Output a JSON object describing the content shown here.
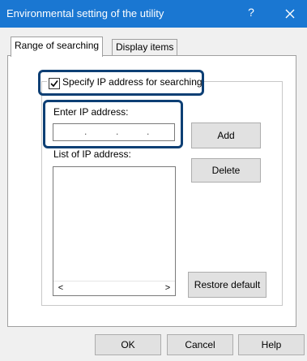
{
  "window": {
    "title": "Environmental setting of the utility",
    "help_label": "?"
  },
  "tabs": [
    {
      "label": "Range of searching"
    },
    {
      "label": "Display items"
    }
  ],
  "search": {
    "checkbox_label": "Specify IP address for searching",
    "checked": true,
    "ip_label": "Enter IP address:",
    "ip_separators": [
      ".",
      ".",
      "."
    ],
    "add_label": "Add",
    "list_label": "List of IP address:",
    "delete_label": "Delete",
    "restore_label": "Restore default",
    "scroll_left": "<",
    "scroll_right": ">"
  },
  "footer": {
    "ok_label": "OK",
    "cancel_label": "Cancel",
    "help_label": "Help"
  },
  "colors": {
    "titlebar": "#1a77d2",
    "highlight": "#0d3f74"
  }
}
